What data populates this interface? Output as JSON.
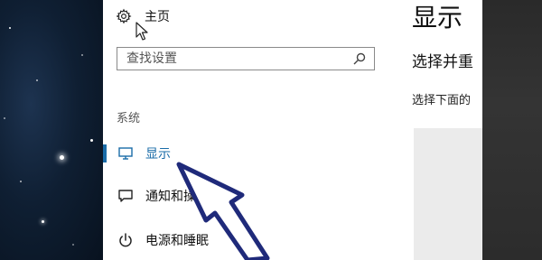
{
  "sidebar": {
    "home_label": "主页",
    "search_placeholder": "查找设置",
    "section_header": "系统",
    "items": [
      {
        "label": "显示",
        "icon": "monitor-icon",
        "active": true
      },
      {
        "label": "通知和操作",
        "icon": "notification-icon",
        "active": false
      },
      {
        "label": "电源和睡眠",
        "icon": "power-icon",
        "active": false
      }
    ]
  },
  "content": {
    "title": "显示",
    "subtitle": "选择并重",
    "description": "选择下面的"
  },
  "colors": {
    "accent": "#1a6ca8",
    "annotation_arrow": "#1f2a7a"
  }
}
